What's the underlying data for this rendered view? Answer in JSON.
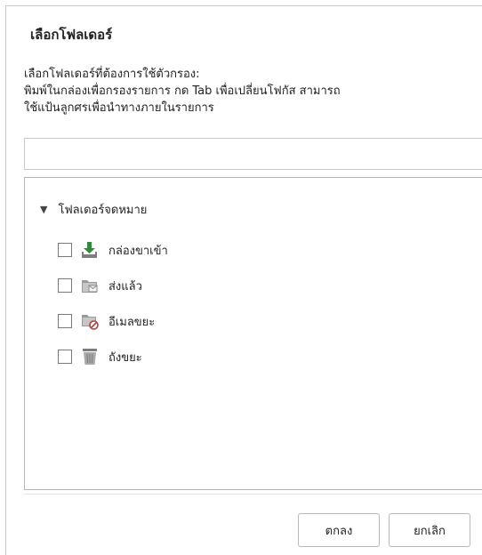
{
  "dialog": {
    "title": "เลือกโฟลเดอร์",
    "instructions": [
      "เลือกโฟลเดอร์ที่ต้องการใช้ตัวกรอง:",
      "พิมพ์ในกล่องเพื่อกรองรายการ กด Tab เพื่อเปลี่ยนโฟกัส สามารถ",
      "ใช้แป้นลูกศรเพื่อนำทางภายในรายการ"
    ],
    "filter": {
      "value": "",
      "placeholder": ""
    }
  },
  "tree": {
    "root": {
      "label": "โฟลเดอร์จดหมาย",
      "expanded": true,
      "arrow": "▼"
    },
    "items": [
      {
        "label": "กล่องขาเข้า",
        "icon": "inbox-download-icon",
        "checked": false
      },
      {
        "label": "ส่งแล้ว",
        "icon": "sent-folder-icon",
        "checked": false
      },
      {
        "label": "อีเมลขยะ",
        "icon": "junk-folder-icon",
        "checked": false
      },
      {
        "label": "ถังขยะ",
        "icon": "trash-can-icon",
        "checked": false
      }
    ]
  },
  "buttons": {
    "ok": "ตกลง",
    "cancel": "ยกเลิก"
  },
  "colors": {
    "icon_green": "#2e8b3a",
    "icon_gray": "#8a8a8a",
    "junk_red": "#c23a3a"
  }
}
